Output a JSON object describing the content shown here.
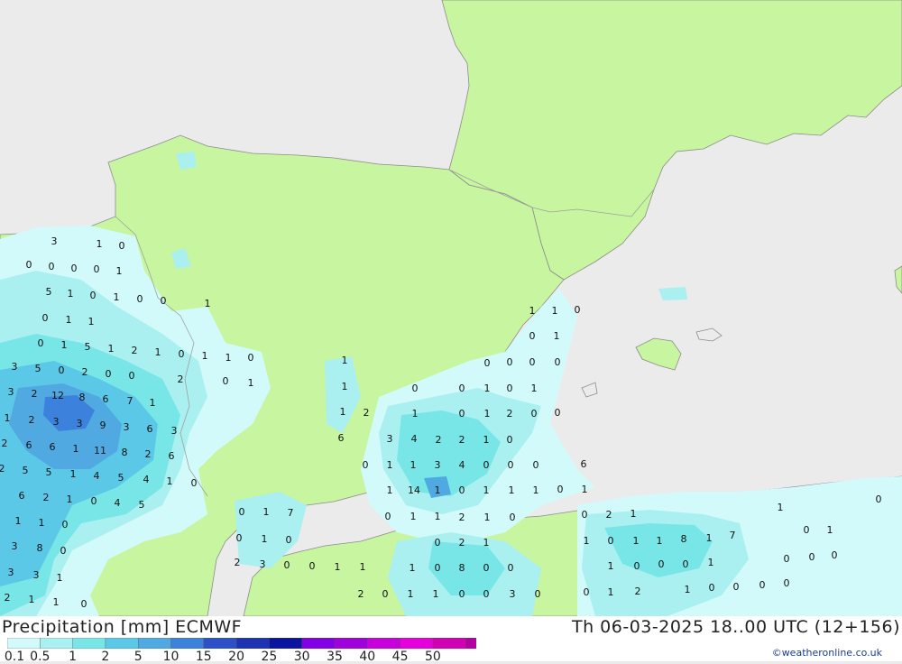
{
  "title": "Precipitation [mm] ECMWF",
  "timestamp": "Th 06-03-2025 18..00 UTC (12+156)",
  "credit": "©weatheronline.co.uk",
  "colors": {
    "sea": "#ebebeb",
    "land": "#c8f5a0",
    "border": "#a0a0a0",
    "scale": [
      "#d2fafa",
      "#aaf0f0",
      "#78e6e6",
      "#5ac8e6",
      "#50aae1",
      "#3c82dc",
      "#2d50c8",
      "#1e32b4",
      "#0a14a0",
      "#8200e6",
      "#a000dc",
      "#c800dc",
      "#e600dc",
      "#d200b4",
      "#b400a0"
    ]
  },
  "legend": {
    "ticks": [
      "0.1",
      "0.5",
      "1",
      "2",
      "5",
      "10",
      "15",
      "20",
      "25",
      "30",
      "35",
      "40",
      "45",
      "50"
    ]
  },
  "values": [
    "3",
    "1",
    "0",
    "0",
    "0",
    "0",
    "0",
    "1",
    "5",
    "1",
    "0",
    "1",
    "0",
    "0",
    "1",
    "0",
    "1",
    "1",
    "0",
    "1",
    "5",
    "1",
    "2",
    "1",
    "0",
    "1",
    "1",
    "0",
    "2",
    "0",
    "1",
    "3",
    "5",
    "0",
    "2",
    "0",
    "0",
    "3",
    "2",
    "12",
    "8",
    "6",
    "7",
    "1",
    "1",
    "2",
    "3",
    "3",
    "9",
    "3",
    "6",
    "3",
    "2",
    "6",
    "6",
    "1",
    "11",
    "8",
    "2",
    "6",
    "2",
    "5",
    "5",
    "1",
    "4",
    "5",
    "4",
    "1",
    "0",
    "6",
    "2",
    "1",
    "0",
    "4",
    "5",
    "1",
    "1",
    "0",
    "3",
    "8",
    "0",
    "3",
    "3",
    "1",
    "2",
    "1",
    "1",
    "0",
    "1",
    "1",
    "0",
    "0",
    "1",
    "0",
    "0",
    "0",
    "0",
    "1",
    "1",
    "0",
    "0",
    "1",
    "0",
    "1",
    "1",
    "2",
    "1",
    "0",
    "1",
    "2",
    "0",
    "0",
    "6",
    "0",
    "1",
    "3",
    "4",
    "2",
    "2",
    "1",
    "0",
    "0",
    "1",
    "1",
    "3",
    "4",
    "0",
    "0",
    "0",
    "6",
    "1",
    "14",
    "1",
    "0",
    "1",
    "1",
    "1",
    "0",
    "1",
    "1",
    "0",
    "1",
    "2",
    "0",
    "1",
    "7",
    "0",
    "1",
    "1",
    "0",
    "2",
    "0",
    "1",
    "0",
    "0",
    "2",
    "1",
    "2",
    "3",
    "0",
    "0",
    "1",
    "1",
    "1",
    "0",
    "8",
    "0",
    "0",
    "0",
    "1",
    "1",
    "0",
    "1",
    "1",
    "8",
    "1",
    "7",
    "1",
    "0",
    "0",
    "0",
    "1",
    "0",
    "0",
    "0",
    "2",
    "0",
    "1",
    "1",
    "0",
    "0",
    "3",
    "0",
    "0",
    "1",
    "2",
    "1",
    "0",
    "0",
    "0",
    "0"
  ]
}
